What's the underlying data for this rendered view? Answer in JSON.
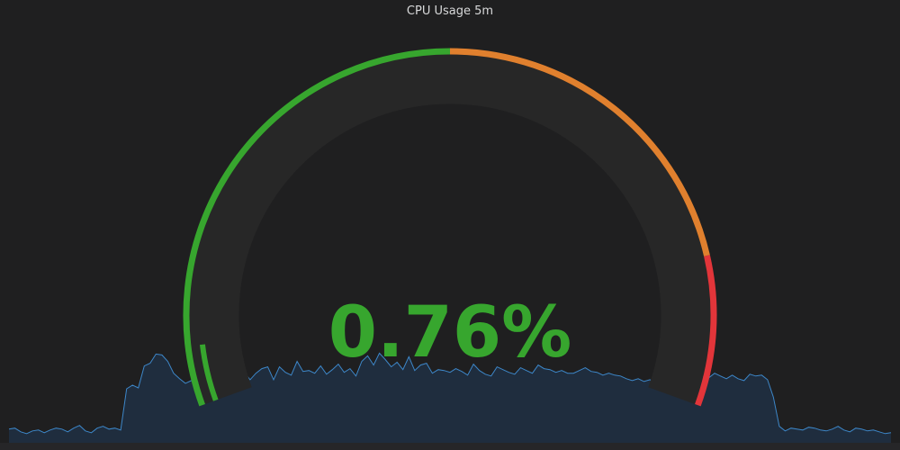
{
  "panel": {
    "title": "CPU Usage 5m",
    "value_text": "0.76%"
  },
  "gauge": {
    "min": 0,
    "max": 100,
    "value": 0.76,
    "thresholds": [
      {
        "from": 0,
        "to": 50,
        "color": "#37a62e"
      },
      {
        "from": 50,
        "to": 85,
        "color": "#e0802e"
      },
      {
        "from": 85,
        "to": 100,
        "color": "#e2353a"
      }
    ],
    "track_color": "#272727",
    "value_color": "#37a62e"
  },
  "sparkline": {
    "line_color": "#3d87c9",
    "fill_color": "#1f2d3e",
    "values": [
      1.5,
      1.6,
      1.2,
      1.0,
      1.3,
      1.4,
      1.1,
      1.4,
      1.6,
      1.5,
      1.2,
      1.6,
      1.9,
      1.3,
      1.1,
      1.6,
      1.8,
      1.5,
      1.6,
      1.4,
      5.9,
      6.3,
      6.0,
      8.4,
      8.7,
      9.7,
      9.6,
      8.9,
      7.6,
      7.0,
      6.5,
      6.8,
      6.6,
      6.9,
      7.0,
      7.2,
      7.3,
      6.8,
      7.0,
      6.7,
      7.7,
      6.9,
      7.6,
      8.1,
      8.3,
      6.9,
      8.3,
      7.7,
      7.4,
      8.9,
      7.8,
      7.9,
      7.6,
      8.4,
      7.5,
      8.0,
      8.6,
      7.7,
      8.1,
      7.3,
      8.9,
      9.5,
      8.5,
      9.8,
      9.1,
      8.3,
      8.8,
      8.0,
      9.4,
      7.9,
      8.5,
      8.7,
      7.6,
      8.0,
      7.9,
      7.7,
      8.1,
      7.8,
      7.4,
      8.6,
      7.9,
      7.5,
      7.3,
      8.3,
      8.0,
      7.7,
      7.5,
      8.2,
      7.9,
      7.6,
      8.5,
      8.1,
      8.0,
      7.7,
      7.9,
      7.6,
      7.6,
      7.9,
      8.2,
      7.8,
      7.7,
      7.4,
      7.6,
      7.4,
      7.3,
      7.0,
      6.8,
      7.0,
      6.7,
      6.9,
      6.6,
      6.5,
      6.6,
      6.9,
      7.2,
      7.0,
      6.8,
      7.1,
      7.3,
      7.1,
      7.6,
      7.3,
      7.0,
      7.4,
      7.0,
      6.8,
      7.5,
      7.3,
      7.4,
      6.9,
      5.0,
      1.8,
      1.3,
      1.6,
      1.5,
      1.4,
      1.7,
      1.6,
      1.4,
      1.3,
      1.5,
      1.8,
      1.4,
      1.2,
      1.6,
      1.5,
      1.3,
      1.4,
      1.2,
      1.0,
      1.1
    ]
  }
}
